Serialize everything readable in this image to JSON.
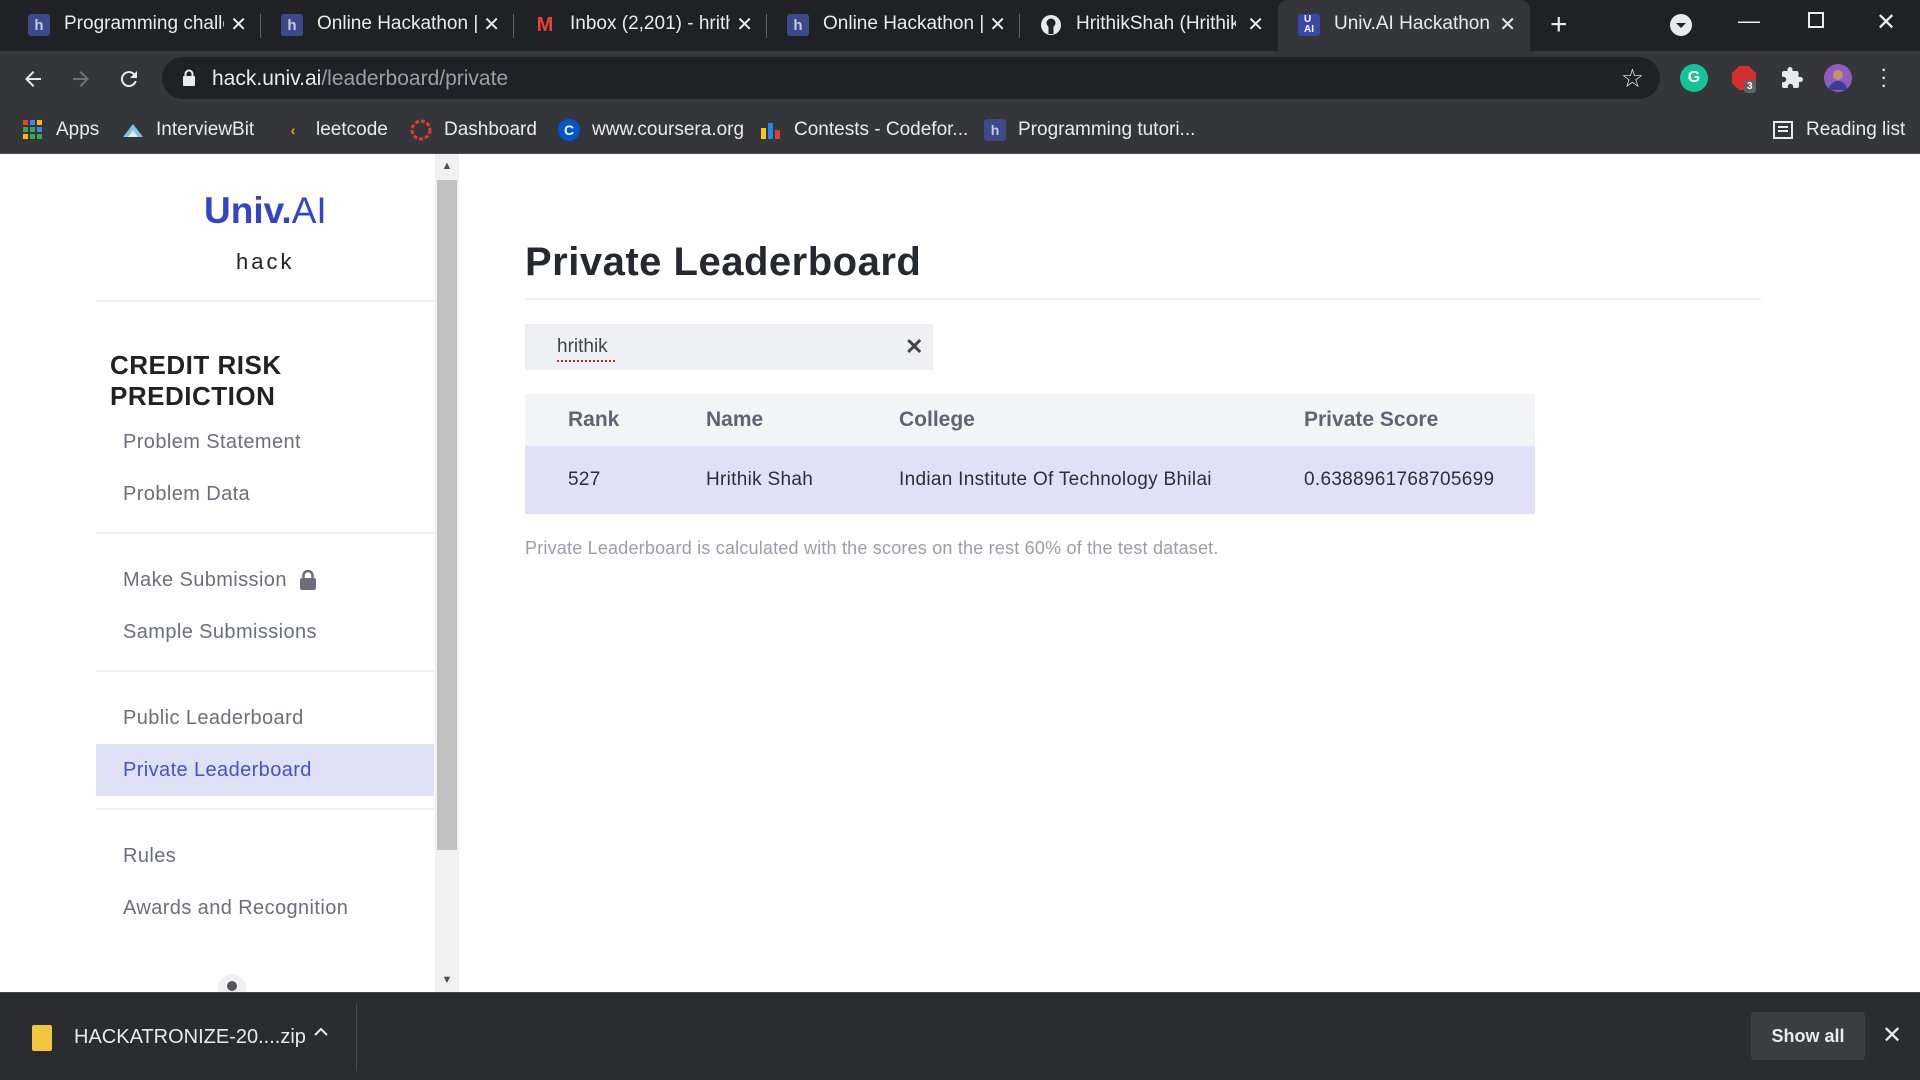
{
  "browser": {
    "tabs": [
      {
        "title": "Programming challe",
        "icon": "hackerearth-icon",
        "active": false
      },
      {
        "title": "Online Hackathon |",
        "icon": "hackerearth-icon",
        "active": false
      },
      {
        "title": "Inbox (2,201) - hrith",
        "icon": "gmail-icon",
        "active": false
      },
      {
        "title": "Online Hackathon |",
        "icon": "hackerearth-icon",
        "active": false
      },
      {
        "title": "HrithikShah (Hrithik",
        "icon": "github-icon",
        "active": false
      },
      {
        "title": "Univ.AI Hackathon",
        "icon": "univai-icon",
        "active": true
      }
    ],
    "url_host": "hack.univ.ai",
    "url_path": "/leaderboard/private",
    "extension_badge": "3",
    "bookmarks": [
      {
        "label": "Apps",
        "icon": "apps-grid-icon"
      },
      {
        "label": "InterviewBit",
        "icon": "interviewbit-icon"
      },
      {
        "label": "leetcode",
        "icon": "leetcode-icon"
      },
      {
        "label": "Dashboard",
        "icon": "dashboard-icon"
      },
      {
        "label": "www.coursera.org",
        "icon": "coursera-icon"
      },
      {
        "label": "Contests - Codefor...",
        "icon": "codeforces-icon"
      },
      {
        "label": "Programming tutori...",
        "icon": "hackerearth-icon"
      }
    ],
    "reading_list": "Reading list"
  },
  "sidebar": {
    "logo_bold": "Univ.",
    "logo_light": "AI",
    "logo_sub": "hack",
    "competition_title": "CREDIT RISK PREDICTION",
    "items": [
      {
        "label": "Problem Statement",
        "active": false
      },
      {
        "label": "Problem Data",
        "active": false
      },
      {
        "label": "Make Submission",
        "active": false,
        "locked": true
      },
      {
        "label": "Sample Submissions",
        "active": false
      },
      {
        "label": "Public Leaderboard",
        "active": false
      },
      {
        "label": "Private Leaderboard",
        "active": true
      },
      {
        "label": "Rules",
        "active": false
      },
      {
        "label": "Awards and Recognition",
        "active": false
      }
    ]
  },
  "main": {
    "title": "Private Leaderboard",
    "search_value": "hrithik",
    "table": {
      "headers": [
        "Rank",
        "Name",
        "College",
        "Private Score"
      ],
      "rows": [
        [
          "527",
          "Hrithik Shah",
          "Indian Institute Of Technology Bhilai",
          "0.6388961768705699"
        ]
      ]
    },
    "note": "Private Leaderboard is calculated with the scores on the rest 60% of the test dataset."
  },
  "downloads": {
    "file_name": "HACKATRONIZE-20....zip",
    "show_all": "Show all"
  },
  "colors": {
    "accent": "#3344cc",
    "active_bg": "#dfe2f6",
    "chrome_dark": "#202124",
    "chrome_mid": "#35363a"
  }
}
